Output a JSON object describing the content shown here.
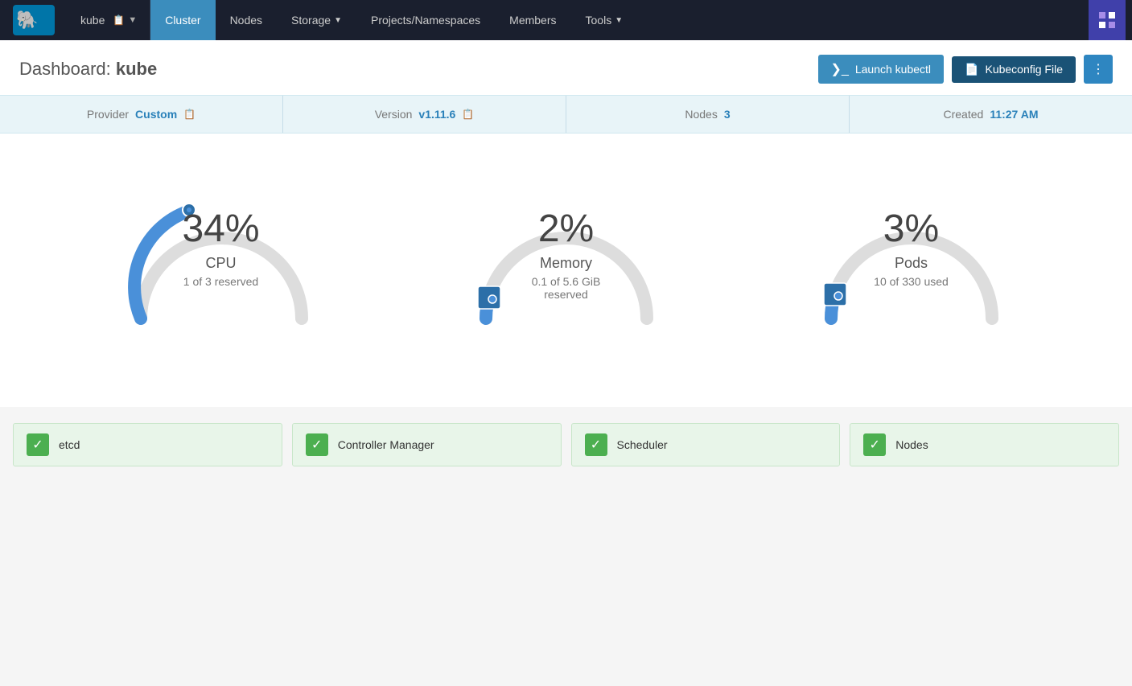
{
  "nav": {
    "logo_alt": "Rancher Logo",
    "kube_label": "kube",
    "kube_icon": "📋",
    "items": [
      {
        "label": "Cluster",
        "active": true,
        "has_chevron": false
      },
      {
        "label": "Nodes",
        "active": false,
        "has_chevron": false
      },
      {
        "label": "Storage",
        "active": false,
        "has_chevron": true
      },
      {
        "label": "Projects/Namespaces",
        "active": false,
        "has_chevron": false
      },
      {
        "label": "Members",
        "active": false,
        "has_chevron": false
      },
      {
        "label": "Tools",
        "active": false,
        "has_chevron": true
      }
    ]
  },
  "header": {
    "title_prefix": "Dashboard:",
    "title_cluster": "kube",
    "launch_kubectl_label": "Launch kubectl",
    "kubeconfig_label": "Kubeconfig File",
    "more_icon": "⋮"
  },
  "info_bar": {
    "provider_label": "Provider",
    "provider_value": "Custom",
    "version_label": "Version",
    "version_value": "v1.11.6",
    "nodes_label": "Nodes",
    "nodes_value": "3",
    "created_label": "Created",
    "created_value": "11:27 AM"
  },
  "gauges": [
    {
      "id": "cpu",
      "percent": "34%",
      "label": "CPU",
      "sublabel": "1 of 3 reserved",
      "value": 34,
      "color": "#4a90d9",
      "track_color": "#ddd"
    },
    {
      "id": "memory",
      "percent": "2%",
      "label": "Memory",
      "sublabel": "0.1 of 5.6 GiB reserved",
      "value": 2,
      "color": "#4a90d9",
      "track_color": "#ddd"
    },
    {
      "id": "pods",
      "percent": "3%",
      "label": "Pods",
      "sublabel": "10 of 330 used",
      "value": 3,
      "color": "#4a90d9",
      "track_color": "#ddd"
    }
  ],
  "status_items": [
    {
      "label": "etcd",
      "status": "ok"
    },
    {
      "label": "Controller Manager",
      "status": "ok"
    },
    {
      "label": "Scheduler",
      "status": "ok"
    },
    {
      "label": "Nodes",
      "status": "ok"
    }
  ]
}
